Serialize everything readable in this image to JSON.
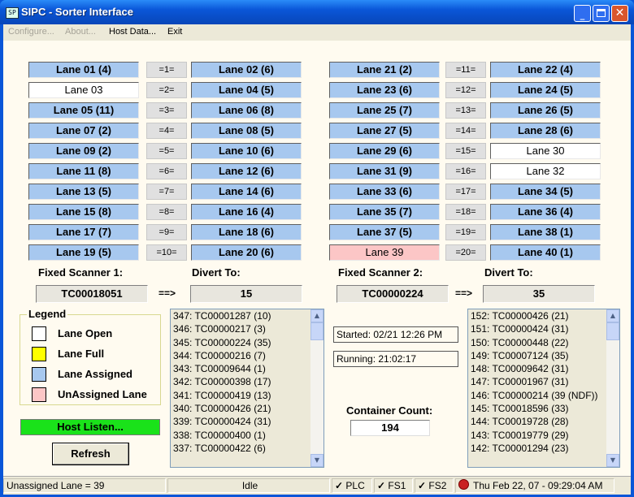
{
  "window": {
    "title": "SIPC - Sorter Interface",
    "icon_text": "SP"
  },
  "menu": [
    "Configure...",
    "About...",
    "Host Data...",
    "Exit"
  ],
  "lanes_left": {
    "left": [
      "Lane 01 (4)",
      "Lane 03",
      "Lane 05 (11)",
      "Lane 07 (2)",
      "Lane 09 (2)",
      "Lane 11 (8)",
      "Lane 13 (5)",
      "Lane 15 (8)",
      "Lane 17 (7)",
      "Lane 19 (5)"
    ],
    "pairs": [
      "=1=",
      "=2=",
      "=3=",
      "=4=",
      "=5=",
      "=6=",
      "=7=",
      "=8=",
      "=9=",
      "=10="
    ],
    "right": [
      "Lane 02 (6)",
      "Lane 04 (5)",
      "Lane 06 (8)",
      "Lane 08 (5)",
      "Lane 10 (6)",
      "Lane 12 (6)",
      "Lane 14 (6)",
      "Lane 16 (4)",
      "Lane 18 (6)",
      "Lane 20 (6)"
    ]
  },
  "lanes_right": {
    "left": [
      "Lane 21 (2)",
      "Lane 23 (6)",
      "Lane 25 (7)",
      "Lane 27 (5)",
      "Lane 29 (6)",
      "Lane 31 (9)",
      "Lane 33 (6)",
      "Lane 35 (7)",
      "Lane 37 (5)",
      "Lane 39"
    ],
    "pairs": [
      "=11=",
      "=12=",
      "=13=",
      "=14=",
      "=15=",
      "=16=",
      "=17=",
      "=18=",
      "=19=",
      "=20="
    ],
    "right": [
      "Lane 22 (4)",
      "Lane 24 (5)",
      "Lane 26 (5)",
      "Lane 28 (6)",
      "Lane 30",
      "Lane 32",
      "Lane 34 (5)",
      "Lane 36 (4)",
      "Lane 38 (1)",
      "Lane 40 (1)"
    ]
  },
  "lane_states": {
    "open": [
      "Lane 03",
      "Lane 30",
      "Lane 32"
    ],
    "unassigned": [
      "Lane 39"
    ]
  },
  "scanner1": {
    "label": "Fixed Scanner 1:",
    "divert_label": "Divert To:",
    "value": "TC00018051",
    "arrow": "==>",
    "divert": "15"
  },
  "scanner2": {
    "label": "Fixed Scanner 2:",
    "divert_label": "Divert To:",
    "value": "TC00000224",
    "arrow": "==>",
    "divert": "35"
  },
  "legend": {
    "title": "Legend",
    "items": [
      {
        "label": "Lane Open",
        "color": "#ffffff"
      },
      {
        "label": "Lane Full",
        "color": "#ffff00"
      },
      {
        "label": "Lane Assigned",
        "color": "#a7c8ef"
      },
      {
        "label": "UnAssigned Lane",
        "color": "#fcc6c6"
      }
    ]
  },
  "host_status": "Host Listen...",
  "refresh_label": "Refresh",
  "log1": [
    "347: TC00001287 (10)",
    "346: TC00000217 (3)",
    "345: TC00000224 (35)",
    "344: TC00000216 (7)",
    "343: TC00009644 (1)",
    "342: TC00000398 (17)",
    "341: TC00000419 (13)",
    "340: TC00000426 (21)",
    "339: TC00000424 (31)",
    "338: TC00000400 (1)",
    "337: TC00000422 (6)"
  ],
  "log2": [
    "152: TC00000426 (21)",
    "151: TC00000424 (31)",
    "150: TC00000448 (22)",
    "149: TC00007124 (35)",
    "148: TC00009642 (31)",
    "147: TC00001967 (31)",
    "146: TC00000214 (39 (NDF))",
    "145: TC00018596 (33)",
    "144: TC00019728 (28)",
    "143: TC00019779 (29)",
    "142: TC00001294 (23)"
  ],
  "started": "Started: 02/21 12:26 PM",
  "running": "Running: 21:02:17",
  "container_count_label": "Container Count:",
  "container_count": "194",
  "statusbar": {
    "unassigned": "Unassigned Lane = 39",
    "state": "Idle",
    "plc": "PLC",
    "fs1": "FS1",
    "fs2": "FS2",
    "datetime": "Thu Feb 22, 07 - 09:29:04 AM"
  }
}
